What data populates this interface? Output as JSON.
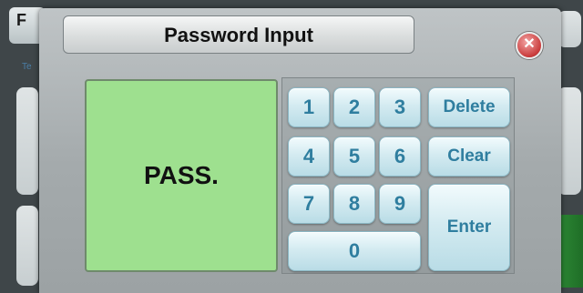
{
  "background": {
    "window_title": "F",
    "side_text": "Te"
  },
  "dialog": {
    "title": "Password Input",
    "close_icon": "close-icon",
    "display_text": "PASS."
  },
  "keypad": {
    "digits": [
      "1",
      "2",
      "3",
      "4",
      "5",
      "6",
      "7",
      "8",
      "9",
      "0"
    ],
    "delete_label": "Delete",
    "clear_label": "Clear",
    "enter_label": "Enter"
  },
  "colors": {
    "display_bg": "#9ee08f",
    "key_text": "#2f7e9f",
    "close_red": "#c93b3b"
  }
}
